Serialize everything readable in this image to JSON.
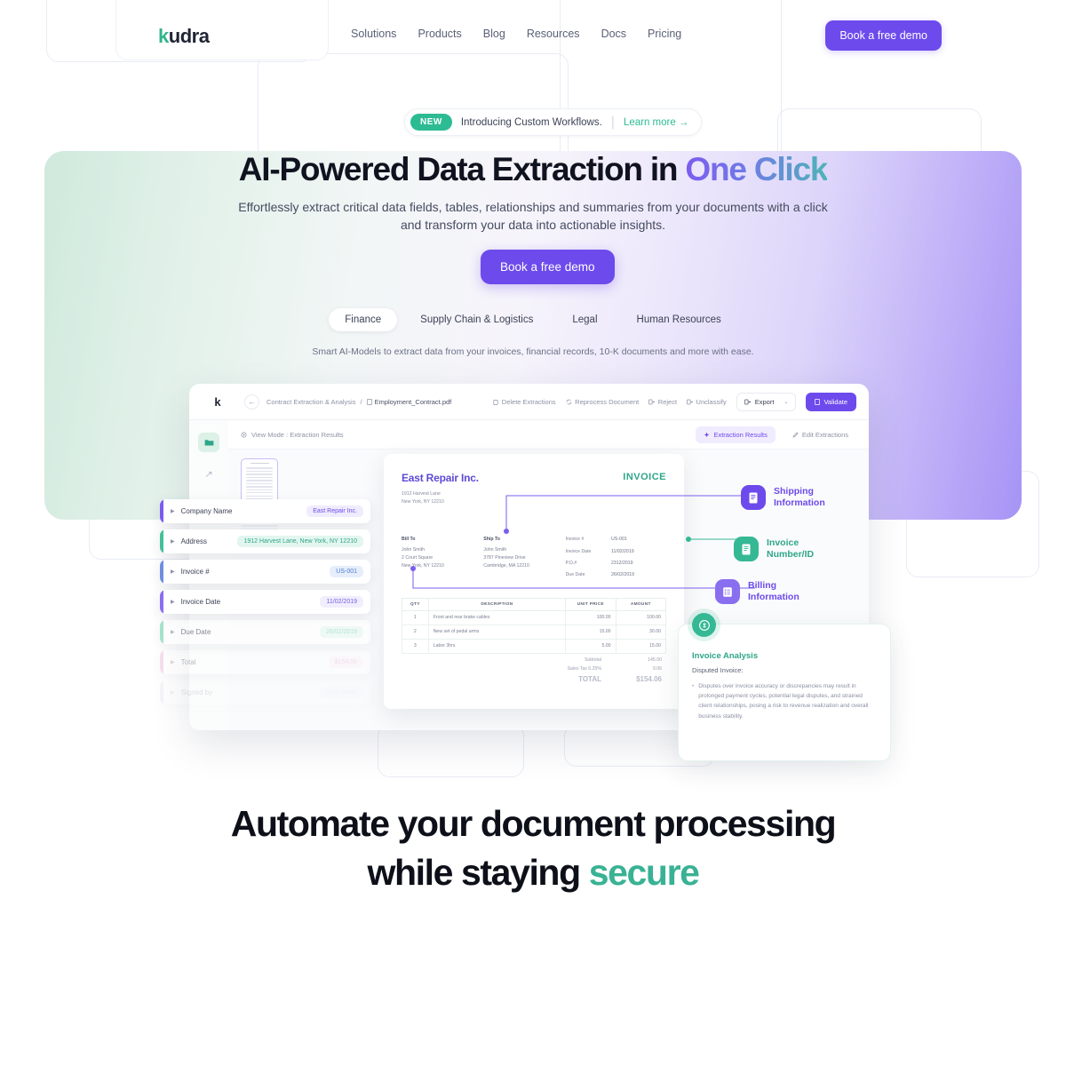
{
  "header": {
    "logo": "kudra",
    "logo_accent_letter": "k",
    "nav": [
      {
        "label": "Solutions"
      },
      {
        "label": "Products"
      },
      {
        "label": "Blog"
      },
      {
        "label": "Resources"
      },
      {
        "label": "Docs"
      },
      {
        "label": "Pricing"
      }
    ],
    "cta_label": "Book a free demo"
  },
  "announcement": {
    "badge": "NEW",
    "text": "Introducing Custom Workflows.",
    "link": "Learn more →"
  },
  "hero": {
    "title_plain": "AI-Powered Data Extraction in ",
    "title_gradient": "One Click",
    "subtitle_line1": "Effortlessly extract critical data fields, tables, relationships and summaries from your documents with a click",
    "subtitle_line2": "and transform your data into actionable insights.",
    "cta_label": "Book a free demo",
    "tabs": [
      {
        "label": "Finance",
        "active": true
      },
      {
        "label": "Supply Chain & Logistics",
        "active": false
      },
      {
        "label": "Legal",
        "active": false
      },
      {
        "label": "Human Resources",
        "active": false
      }
    ],
    "tagline": "Smart AI-Models to extract data from your invoices, financial records, 10-K documents and more with ease."
  },
  "app": {
    "logo": "k",
    "breadcrumb_root": "Contract Extraction & Analysis",
    "breadcrumb_sep": "/",
    "breadcrumb_file": "Employment_Contract.pdf",
    "toolbar": [
      {
        "label": "Delete Extractions",
        "icon": "trash-icon"
      },
      {
        "label": "Reprocess Document",
        "icon": "refresh-icon"
      },
      {
        "label": "Reject",
        "icon": "reject-icon"
      },
      {
        "label": "Unclassify",
        "icon": "unclassify-icon"
      }
    ],
    "export_label": "Export",
    "export_caret": "⌄",
    "validate_label": "Validate",
    "view_mode_label": "View Mode : Extraction Results",
    "view_tabs": [
      {
        "label": "Extraction Results",
        "active": true
      },
      {
        "label": "Edit Extractions",
        "active": false
      }
    ]
  },
  "extraction_fields": [
    {
      "label": "Company Name",
      "value": "East Repair Inc.",
      "accent": "#7b5cf0",
      "value_bg": "#efecfd",
      "value_color": "#6d4aec",
      "opacity": 1
    },
    {
      "label": "Address",
      "value": "1912 Harvest Lane, New York, NY 12210",
      "accent": "#44bf9a",
      "value_bg": "#e2f6ef",
      "value_color": "#2fa58a",
      "opacity": 1
    },
    {
      "label": "Invoice #",
      "value": "US-001",
      "accent": "#6d8fe0",
      "value_bg": "#e6eefb",
      "value_color": "#4f7ad0",
      "opacity": 1
    },
    {
      "label": "Invoice Date",
      "value": "11/02/2019",
      "accent": "#8a6ef0",
      "value_bg": "#f1eefd",
      "value_color": "#7a5fe3",
      "opacity": 1
    },
    {
      "label": "Due Date",
      "value": "26/02/2019",
      "accent": "#6ed3ab",
      "value_bg": "#e8f8f1",
      "value_color": "#8fd9bf",
      "opacity": 0.6
    },
    {
      "label": "Total",
      "value": "$154.06",
      "accent": "#e9a6cf",
      "value_bg": "#fbeef6",
      "value_color": "#e2aed0",
      "opacity": 0.35
    },
    {
      "label": "Signed by",
      "value": "John Smith",
      "accent": "#b9c0d4",
      "value_bg": "#f2eefb",
      "value_color": "#cfc6ea",
      "opacity": 0.15
    }
  ],
  "invoice": {
    "company": "East Repair Inc.",
    "doc_word": "INVOICE",
    "address_line1": "1912 Harvest Lane",
    "address_line2": "New York, NY 12210",
    "bill_to_title": "Bill To",
    "bill_to": [
      "John Smith",
      "2 Court Square",
      "New York, NY 12210"
    ],
    "ship_to_title": "Ship To",
    "ship_to": [
      "John Smith",
      "3787 Pineview Drive",
      "Cambridge, MA 12210"
    ],
    "meta": [
      {
        "label": "Invoice #",
        "value": "US-001"
      },
      {
        "label": "Invoice Date",
        "value": "11/02/2019"
      },
      {
        "label": "P.O.#",
        "value": "2312/2019"
      },
      {
        "label": "Due Date",
        "value": "26/02/2019"
      }
    ],
    "columns": [
      "QTY",
      "DESCRIPTION",
      "UNIT PRICE",
      "AMOUNT"
    ],
    "rows": [
      {
        "qty": "1",
        "desc": "Front and rear brake cables",
        "unit": "100.00",
        "amount": "100.00"
      },
      {
        "qty": "2",
        "desc": "New set of pedal arms",
        "unit": "15.00",
        "amount": "30.00"
      },
      {
        "qty": "3",
        "desc": "Labor 3hrs",
        "unit": "5.00",
        "amount": "15.00"
      }
    ],
    "totals": [
      {
        "label": "Subtotal",
        "value": "145.00"
      },
      {
        "label": "Sales Tax 6.25%",
        "value": "9.06"
      }
    ],
    "grand_label": "TOTAL",
    "grand_value": "$154.06"
  },
  "callouts": [
    {
      "label_line1": "Shipping",
      "label_line2": "Information",
      "color": "#6d4aec",
      "bg": "#6d4aec",
      "text_color": "#6d4aec",
      "icon": "document-shipping-icon"
    },
    {
      "label_line1": "Invoice",
      "label_line2": "Number/ID",
      "color": "#2fa58a",
      "bg": "#35b894",
      "text_color": "#2fa58a",
      "icon": "document-invoice-icon"
    },
    {
      "label_line1": "Billing",
      "label_line2": "Information",
      "color": "#6d4aec",
      "bg": "#8a6ef0",
      "text_color": "#6d4aec",
      "icon": "list-billing-icon"
    }
  ],
  "analysis": {
    "icon": "invoice-analysis-icon",
    "title": "Invoice Analysis",
    "subtitle": "Disputed Invoice:",
    "bullet": "Disputes over invoice accuracy or discrepancies may result in prolonged payment cycles, potential legal disputes, and strained client relationships, posing a risk to revenue realization and overall business stability."
  },
  "bottom": {
    "line1": "Automate your document processing",
    "line2_plain": "while staying ",
    "line2_accent": "secure"
  }
}
